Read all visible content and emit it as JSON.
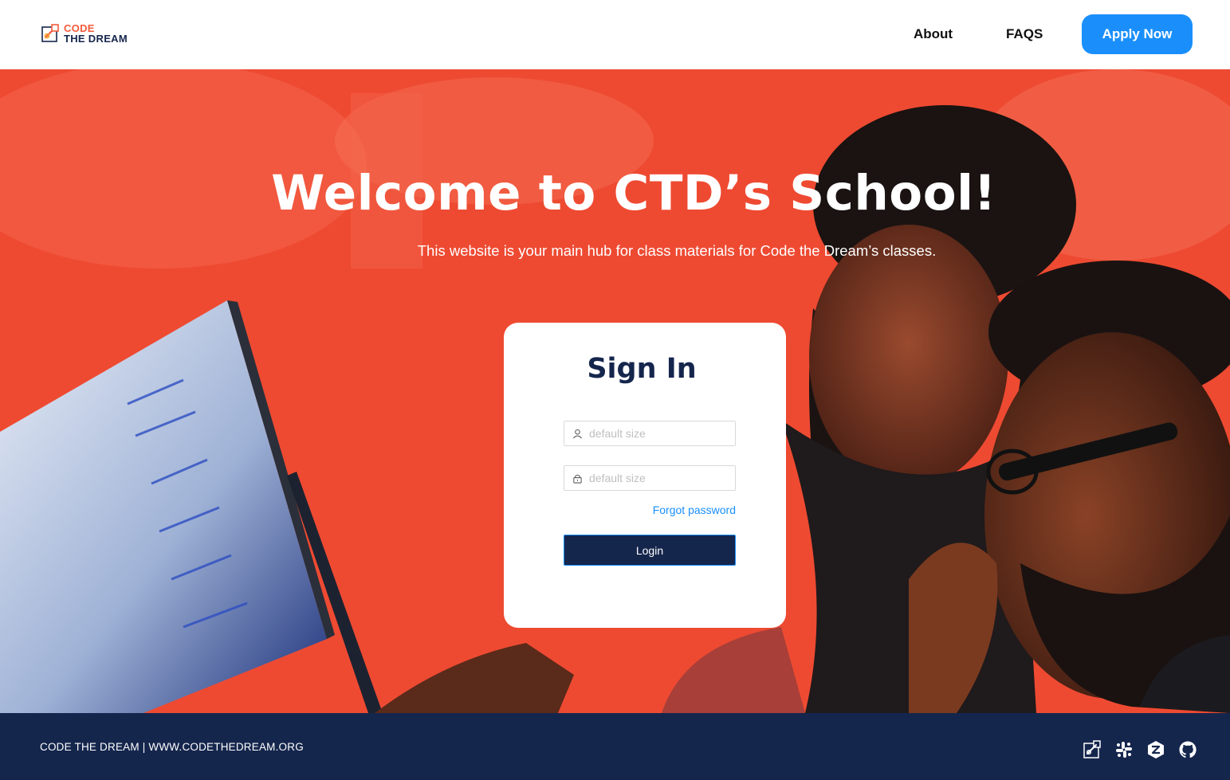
{
  "header": {
    "logo_line1": "CODE",
    "logo_line2": "THE DREAM",
    "nav": {
      "about": "About",
      "faqs": "FAQS"
    },
    "apply_label": "Apply Now"
  },
  "hero": {
    "title": "Welcome to CTD’s School!",
    "subtitle": "This website is your main hub for class materials for Code the Dream’s classes."
  },
  "signin": {
    "title": "Sign In",
    "username": {
      "value": "",
      "placeholder": "default size",
      "icon": "user-icon"
    },
    "password": {
      "value": "",
      "placeholder": "default size",
      "icon": "lock-icon"
    },
    "forgot_label": "Forgot password",
    "login_label": "Login"
  },
  "footer": {
    "text": "CODE THE DREAM | WWW.CODETHEDREAM.ORG",
    "icons": [
      "ctd-link-icon",
      "slack-icon",
      "zulip-icon",
      "github-icon"
    ]
  },
  "colors": {
    "brand_orange": "#f35b3b",
    "navy": "#15264d",
    "accent_blue": "#1a8ffb",
    "hero_red": "#ee4a32"
  }
}
